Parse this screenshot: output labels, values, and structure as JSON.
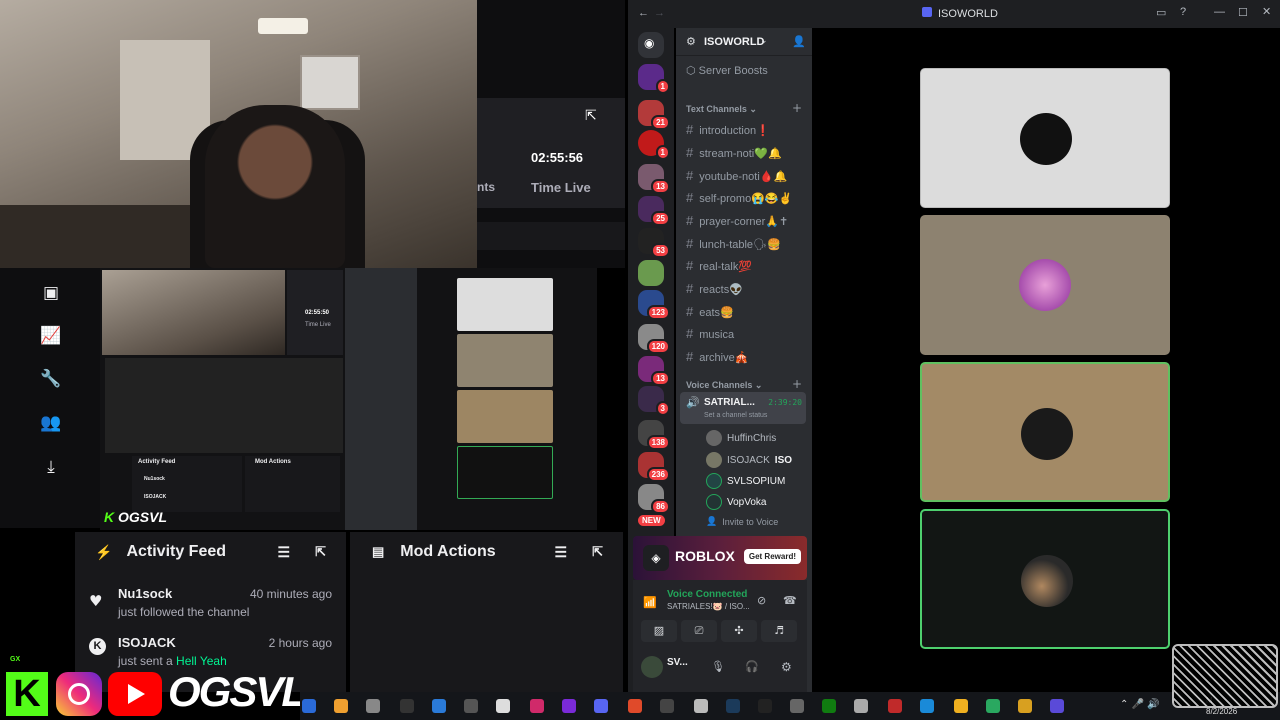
{
  "browser_panel": {
    "time_value": "02:55:56",
    "time_label": "Time Live",
    "partial_label": "nts"
  },
  "sidebar": {
    "icons": [
      "video-icon",
      "analytics-icon",
      "wrench-icon",
      "user-manage-icon",
      "upload-icon"
    ]
  },
  "preview": {
    "time_value": "02:55:50",
    "time_label": "Time Live",
    "activity_title": "Activity Feed",
    "mod_title": "Mod Actions",
    "brand_text": "OGSVL",
    "feed": [
      {
        "name": "Nu1sock",
        "ago": "40 minutes ago",
        "desc": "just followed the channel"
      },
      {
        "name": "ISOJACK",
        "ago": "2 hours ago",
        "desc": "just sent a Hell Yeah"
      }
    ]
  },
  "activity_feed": {
    "title": "Activity Feed",
    "items": [
      {
        "name": "Nu1sock",
        "ago": "40 minutes ago",
        "desc": "just followed the channel",
        "highlight": "",
        "icon": "heart-icon"
      },
      {
        "name": "ISOJACK",
        "ago": "2 hours ago",
        "desc": "just sent a ",
        "highlight": "Hell Yeah",
        "icon": "kick-icon"
      }
    ]
  },
  "mod_actions": {
    "title": "Mod Actions"
  },
  "social": {
    "handle": "OGSVL",
    "corner_label": "GX"
  },
  "discord": {
    "window_title": "ISOWORLD",
    "server_name": "ISOWORLD",
    "server_boosts": "Server Boosts",
    "text_category": "Text Channels",
    "voice_category": "Voice Channels",
    "text_channels": [
      "introduction❗",
      "stream-noti💚🔔",
      "youtube-noti🩸🔔",
      "self-promo😭😂✌",
      "prayer-corner🙏✝",
      "lunch-table🗣🍔",
      "real-talk💯",
      "reacts👽",
      "eats🍔",
      "musica",
      "archive🎪"
    ],
    "voice_channel": {
      "name": "SATRIAL...",
      "timer": "2:39:20",
      "status": "Set a channel status"
    },
    "voice_users": [
      "HuffinChris",
      "ISOJACK",
      "SVLSOPIUM",
      "VopVoka"
    ],
    "iso_tag": "ISO",
    "invite": "Invite to Voice",
    "guild_badges": [
      "1",
      "21",
      "1",
      "13",
      "25",
      "53",
      "123",
      "120",
      "13",
      "3",
      "138",
      "236",
      "86"
    ],
    "new_badge": "NEW",
    "roblox": {
      "title": "ROBLOX",
      "cta": "Get Reward!"
    },
    "voice_connected": {
      "label": "Voice Connected",
      "channel": "SATRIALES!🐷 / ISO..."
    },
    "user_panel": {
      "name": "SV..."
    }
  },
  "taskbar": {
    "date": "8/2/2026",
    "time_partial": "M"
  },
  "colors": {
    "kick_green": "#53fc18",
    "discord_bg": "#1e1f22",
    "channel_bg": "#2b2d31",
    "voice_green": "#23a55a",
    "badge_red": "#f23f43"
  }
}
